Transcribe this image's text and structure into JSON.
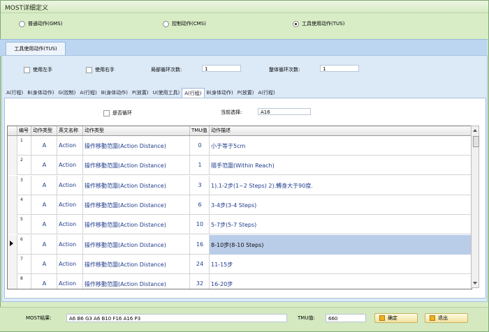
{
  "window": {
    "title": "MOST详细定义"
  },
  "radios": [
    {
      "label": "普通动作(GMS)",
      "checked": false
    },
    {
      "label": "控制动作(CMS)",
      "checked": false
    },
    {
      "label": "工具使用动作(TUS)",
      "checked": true
    }
  ],
  "main_tab": {
    "label": "工具使用动作(TUS)"
  },
  "options": {
    "left_hand": "使用左手",
    "right_hand": "使用右手",
    "local_loop_label": "局部循环次数:",
    "local_loop_value": "1",
    "global_loop_label": "整体循环次数:",
    "global_loop_value": "1"
  },
  "sub_tabs": [
    "A(行程)",
    "B(身体动作)",
    "G(控制)",
    "A(行程)",
    "B(身体动作)",
    "P(放置)",
    "U(使用工具)",
    "A(行程)",
    "B(身体动作)",
    "P(放置)",
    "A(行程)"
  ],
  "sub_tabs_active": 7,
  "loop": {
    "label": "是否循环"
  },
  "current": {
    "label": "当前选择:",
    "value": "A16"
  },
  "table": {
    "headers": [
      "编号",
      "动作类型",
      "英文名称",
      "动作类型",
      "TMU值",
      "动作描述"
    ],
    "rows": [
      {
        "no": "1",
        "type": "A",
        "name": "Action",
        "action": "操作移動范圍(Action Distance)",
        "tmu": "0",
        "desc": "小于等于5cm"
      },
      {
        "no": "2",
        "type": "A",
        "name": "Action",
        "action": "操作移動范圍(Action Distance)",
        "tmu": "1",
        "desc": "隨手范圍(Within Reach)"
      },
      {
        "no": "3",
        "type": "A",
        "name": "Action",
        "action": "操作移動范圍(Action Distance)",
        "tmu": "3",
        "desc": "1).1-2步(1~2 Steps) 2).轉身大于90度."
      },
      {
        "no": "4",
        "type": "A",
        "name": "Action",
        "action": "操作移動范圍(Action Distance)",
        "tmu": "6",
        "desc": "3-4步(3-4 Steps)"
      },
      {
        "no": "5",
        "type": "A",
        "name": "Action",
        "action": "操作移動范圍(Action Distance)",
        "tmu": "10",
        "desc": "5-7步(5-7 Steps)"
      },
      {
        "no": "6",
        "type": "A",
        "name": "Action",
        "action": "操作移動范圍(Action Distance)",
        "tmu": "16",
        "desc": "8-10步(8-10 Steps)"
      },
      {
        "no": "7",
        "type": "A",
        "name": "Action",
        "action": "操作移動范圍(Action Distance)",
        "tmu": "24",
        "desc": "11-15步"
      },
      {
        "no": "8",
        "type": "A",
        "name": "Action",
        "action": "操作移動范圍(Action Distance)",
        "tmu": "32",
        "desc": "16-20步"
      }
    ]
  },
  "footer": {
    "most_label": "MOST结果:",
    "most_value": "A6 B6 G3 A6 B10  F16 A16  P3",
    "tmu_label": "TMU值:",
    "tmu_value": "660",
    "ok": "确定",
    "exit": "退出"
  },
  "colors": {
    "selected_row": "#b9cde9",
    "tab_band": "#bcd6f2",
    "window_bg": "#d8ecc6"
  }
}
